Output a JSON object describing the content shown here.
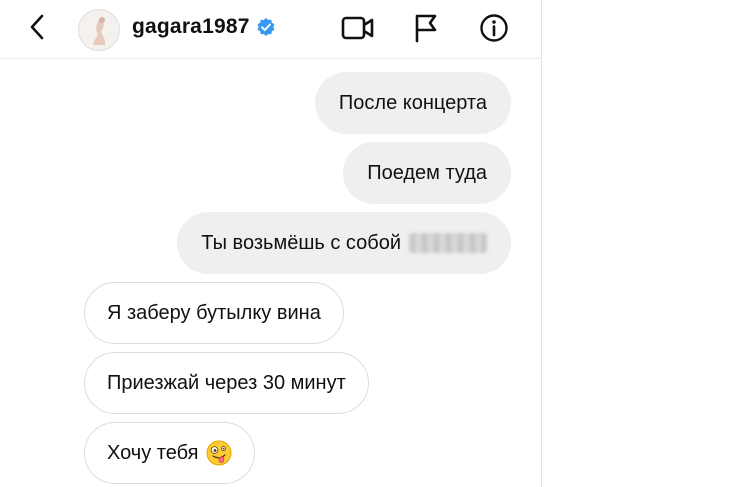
{
  "header": {
    "username": "gagara1987",
    "verified": true,
    "icons": [
      "back-chevron-icon",
      "verified-badge-icon",
      "video-call-icon",
      "report-flag-icon",
      "info-icon"
    ]
  },
  "messages": [
    {
      "side": "outgoing",
      "text": "После концерта"
    },
    {
      "side": "outgoing",
      "text": "Поедем туда"
    },
    {
      "side": "outgoing",
      "text": "Ты возьмёшь с собой",
      "redacted_suffix": true
    },
    {
      "side": "incoming",
      "text": "Я заберу бутылку вина"
    },
    {
      "side": "incoming",
      "text": "Приезжай через 30 минут"
    },
    {
      "side": "incoming",
      "text": "Хочу тебя",
      "emoji": "zany-face-icon"
    }
  ],
  "colors": {
    "outgoing_bubble": "#efefef",
    "incoming_border": "#dcdcdc",
    "verified_blue": "#3897f0",
    "text": "#111111"
  }
}
